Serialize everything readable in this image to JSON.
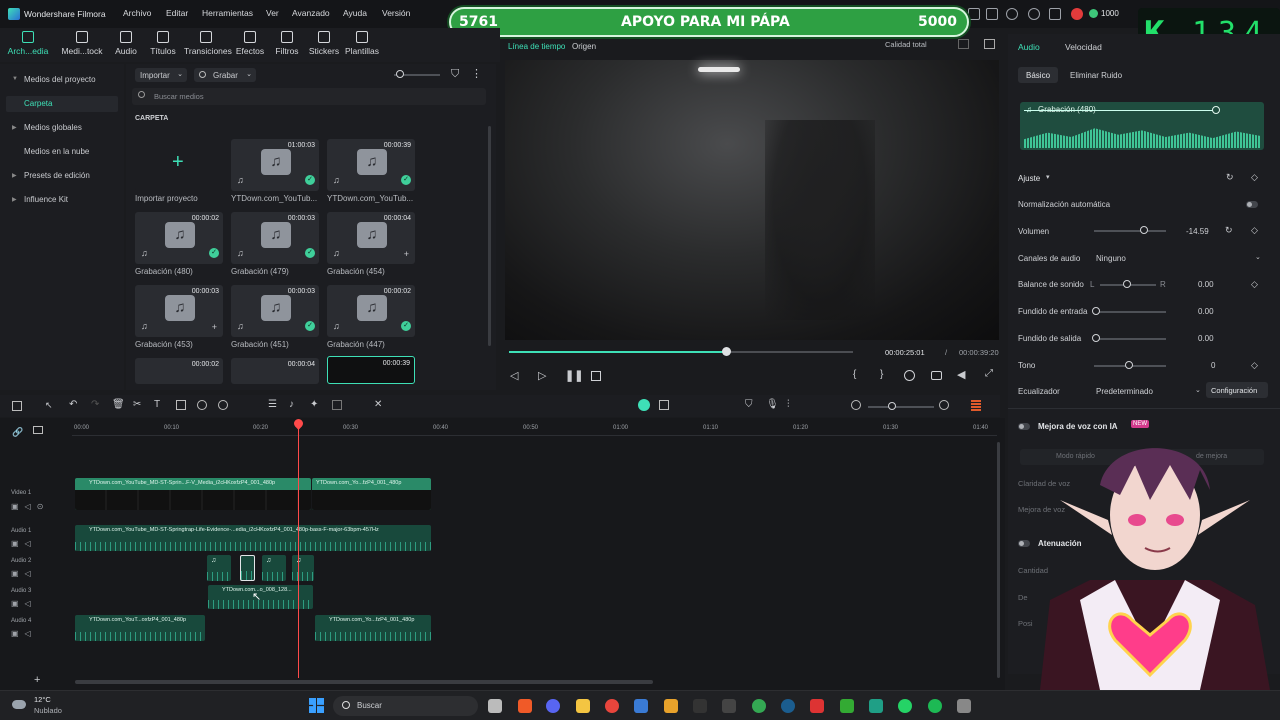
{
  "app": {
    "title": "Wondershare Filmora"
  },
  "menu": [
    "Archivo",
    "Editar",
    "Herramientas",
    "Ver",
    "Avanzado",
    "Ayuda",
    "Versión"
  ],
  "goal": {
    "left": "5761",
    "title": "APOYO PARA MI PÁPA",
    "right": "5000",
    "fill_fraction": 1.0
  },
  "coins": "1000",
  "counter": {
    "letter": "K",
    "value": "134"
  },
  "toolbar": [
    "Arch...edia",
    "Medi...tock",
    "Audio",
    "Títulos",
    "Transiciones",
    "Efectos",
    "Filtros",
    "Stickers",
    "Plantillas"
  ],
  "leftnav": {
    "items": [
      "Medios del proyecto",
      "Carpeta",
      "Medios globales",
      "Medios en la nube",
      "Presets de edición",
      "Influence Kit"
    ]
  },
  "media": {
    "import_label": "Importar",
    "record_label": "Grabar",
    "search_placeholder": "Buscar medios",
    "folder": "CARPETA",
    "items": [
      {
        "label": "Importar proyecto",
        "dur": ""
      },
      {
        "label": "YTDown.com_YouTub...",
        "dur": "01:00:03"
      },
      {
        "label": "YTDown.com_YouTub...",
        "dur": "00:00:39"
      },
      {
        "label": "Grabación (480)",
        "dur": "00:00:02"
      },
      {
        "label": "Grabación (479)",
        "dur": "00:00:03"
      },
      {
        "label": "Grabación (454)",
        "dur": "00:00:04"
      },
      {
        "label": "Grabación (453)",
        "dur": "00:00:03"
      },
      {
        "label": "Grabación (451)",
        "dur": "00:00:03"
      },
      {
        "label": "Grabación (447)",
        "dur": "00:00:02"
      },
      {
        "label": "",
        "dur": "00:00:02"
      },
      {
        "label": "",
        "dur": "00:00:04"
      },
      {
        "label": "",
        "dur": "00:00:39"
      }
    ]
  },
  "preview": {
    "tab_timeline": "Línea de tiempo",
    "tab_source": "Origen",
    "quality": "Calidad total",
    "current_time": "00:00:25:01",
    "separator": "/",
    "total_time": "00:00:39:20",
    "progress": 0.63
  },
  "right": {
    "tab_audio": "Audio",
    "tab_speed": "Velocidad",
    "sub_basic": "Básico",
    "sub_noise": "Eliminar Ruido",
    "clip_name": "Grabación (480)",
    "adjust": "Ajuste",
    "auto_norm": "Normalización automática",
    "volume_label": "Volumen",
    "volume_value": "-14.59",
    "channels_label": "Canales de audio",
    "channels_value": "Ninguno",
    "balance_label": "Balance de sonido",
    "balance_l": "L",
    "balance_r": "R",
    "balance_value": "0.00",
    "fade_in_label": "Fundido de entrada",
    "fade_in_value": "0.00",
    "fade_out_label": "Fundido de salida",
    "fade_out_value": "0.00",
    "tone_label": "Tono",
    "tone_value": "0",
    "eq_label": "Ecualizador",
    "eq_value": "Predeterminado",
    "eq_config": "Configuración",
    "ai_voice": "Mejora de voz con IA",
    "ai_badge": "NEW",
    "quick_mode": "Modo rápido",
    "improve": "de mejora",
    "clarity": "Claridad de voz",
    "voice_improve": "Mejora de voz",
    "attenuation": "Atenuación",
    "amount": "Cantidad",
    "de": "De",
    "pos": "Posi"
  },
  "ruler": [
    "00:00",
    "00:10",
    "00:20",
    "00:30",
    "00:40",
    "00:50",
    "01:00",
    "01:10",
    "01:20",
    "01:30",
    "01:40"
  ],
  "tracks": [
    {
      "label": "Video 1"
    },
    {
      "label": "Audio 1"
    },
    {
      "label": "Audio 2"
    },
    {
      "label": "Audio 3"
    },
    {
      "label": "Audio 4"
    }
  ],
  "clips": {
    "video1a": "YTDown.com_YouTube_MD-ST-Sprin...F-V_Media_i2cHKoxfzP4_001_480p",
    "video1b": "YTDown.com_Yo...fzP4_001_480p",
    "audio1": "YTDown.com_YouTube_MD-ST-Springtrap-Life-Evidence-...edia_i2cHKoxfzP4_001_480p-bass-F-major-63bpm-457Hz",
    "audio3": "YTDown.com...o_008_128...",
    "audio4a": "YTDown.com_YouT...oxfzP4_001_480p",
    "audio4b": "YTDown.com_Yo...fzP4_001_480p"
  },
  "taskbar": {
    "weather_temp": "12°C",
    "weather_desc": "Nublado",
    "search": "Buscar"
  }
}
